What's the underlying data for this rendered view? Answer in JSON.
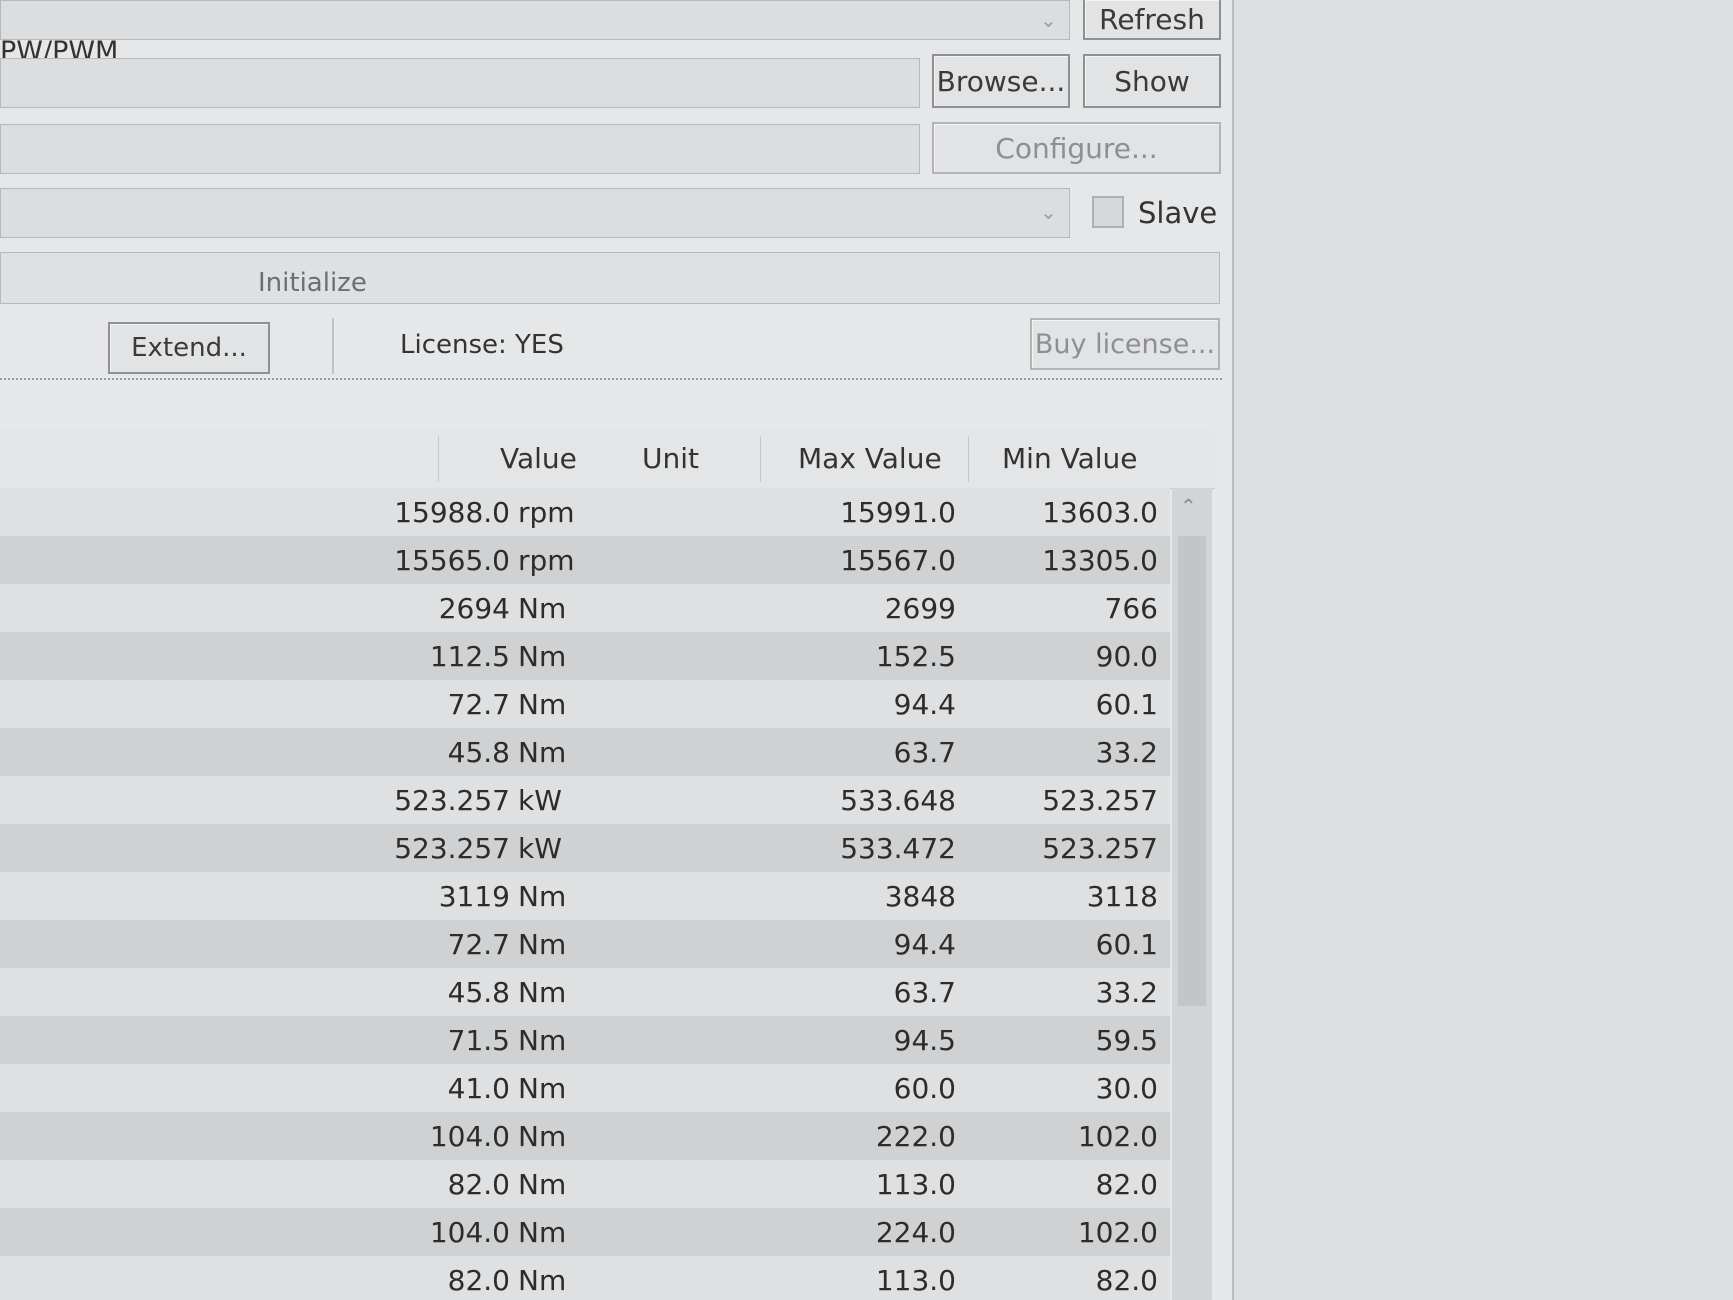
{
  "toolbar": {
    "path_label": "PW/PWM",
    "refresh_label": "Refresh",
    "browse_label": "Browse...",
    "show_label": "Show",
    "configure_label": "Configure...",
    "slave_label": "Slave",
    "initialize_label": "Initialize",
    "extend_label": "Extend...",
    "license_text": "License: YES",
    "buy_license_label": "Buy license..."
  },
  "table": {
    "headers": [
      "Value",
      "Unit",
      "Max Value",
      "Min Value"
    ],
    "rows": [
      {
        "value": "15988.0",
        "unit": "rpm",
        "max": "15991.0",
        "min": "13603.0"
      },
      {
        "value": "15565.0",
        "unit": "rpm",
        "max": "15567.0",
        "min": "13305.0"
      },
      {
        "value": "2694",
        "unit": "Nm",
        "max": "2699",
        "min": "766"
      },
      {
        "value": "112.5",
        "unit": "Nm",
        "max": "152.5",
        "min": "90.0"
      },
      {
        "value": "72.7",
        "unit": "Nm",
        "max": "94.4",
        "min": "60.1"
      },
      {
        "value": "45.8",
        "unit": "Nm",
        "max": "63.7",
        "min": "33.2"
      },
      {
        "value": "523.257",
        "unit": "kW",
        "max": "533.648",
        "min": "523.257"
      },
      {
        "value": "523.257",
        "unit": "kW",
        "max": "533.472",
        "min": "523.257"
      },
      {
        "value": "3119",
        "unit": "Nm",
        "max": "3848",
        "min": "3118"
      },
      {
        "value": "72.7",
        "unit": "Nm",
        "max": "94.4",
        "min": "60.1"
      },
      {
        "value": "45.8",
        "unit": "Nm",
        "max": "63.7",
        "min": "33.2"
      },
      {
        "value": "71.5",
        "unit": "Nm",
        "max": "94.5",
        "min": "59.5"
      },
      {
        "value": "41.0",
        "unit": "Nm",
        "max": "60.0",
        "min": "30.0"
      },
      {
        "value": "104.0",
        "unit": "Nm",
        "max": "222.0",
        "min": "102.0"
      },
      {
        "value": "82.0",
        "unit": "Nm",
        "max": "113.0",
        "min": "82.0"
      },
      {
        "value": "104.0",
        "unit": "Nm",
        "max": "224.0",
        "min": "102.0"
      },
      {
        "value": "82.0",
        "unit": "Nm",
        "max": "113.0",
        "min": "82.0"
      }
    ]
  },
  "icons": {
    "dropdown": "chevron-down-icon",
    "scroll_up": "chevron-up-icon"
  }
}
